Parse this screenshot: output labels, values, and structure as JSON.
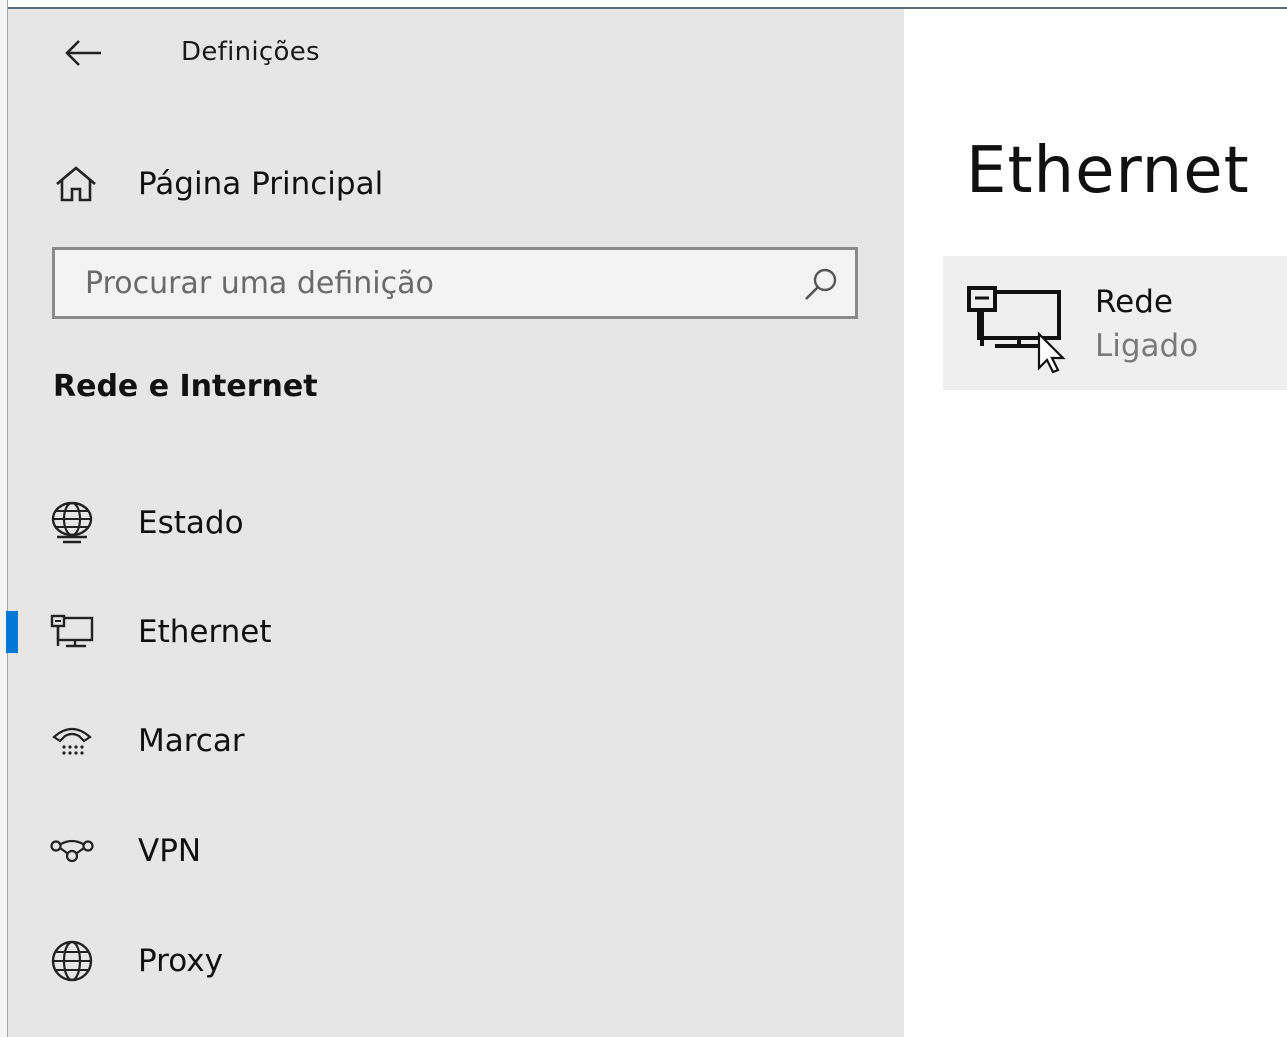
{
  "window": {
    "title": "Definições"
  },
  "sidebar": {
    "back_icon": "back-arrow-icon",
    "home": {
      "label": "Página Principal",
      "icon": "home-icon"
    },
    "search": {
      "placeholder": "Procurar uma definição",
      "value": "",
      "icon": "search-icon"
    },
    "section_title": "Rede e Internet",
    "items": [
      {
        "label": "Estado",
        "icon": "globe-status-icon",
        "selected": false
      },
      {
        "label": "Ethernet",
        "icon": "ethernet-icon",
        "selected": true
      },
      {
        "label": "Marcar",
        "icon": "dial-up-phone-icon",
        "selected": false
      },
      {
        "label": "VPN",
        "icon": "vpn-icon",
        "selected": false
      },
      {
        "label": "Proxy",
        "icon": "globe-icon",
        "selected": false
      }
    ]
  },
  "main": {
    "title": "Ethernet",
    "network": {
      "name": "Rede",
      "status": "Ligado",
      "icon": "ethernet-computer-icon"
    }
  },
  "colors": {
    "sidebar_bg": "#e6e6e6",
    "main_bg": "#ffffff",
    "accent": "#0078d7",
    "card_bg": "#efefef",
    "secondary_text": "#7a7a7a"
  }
}
